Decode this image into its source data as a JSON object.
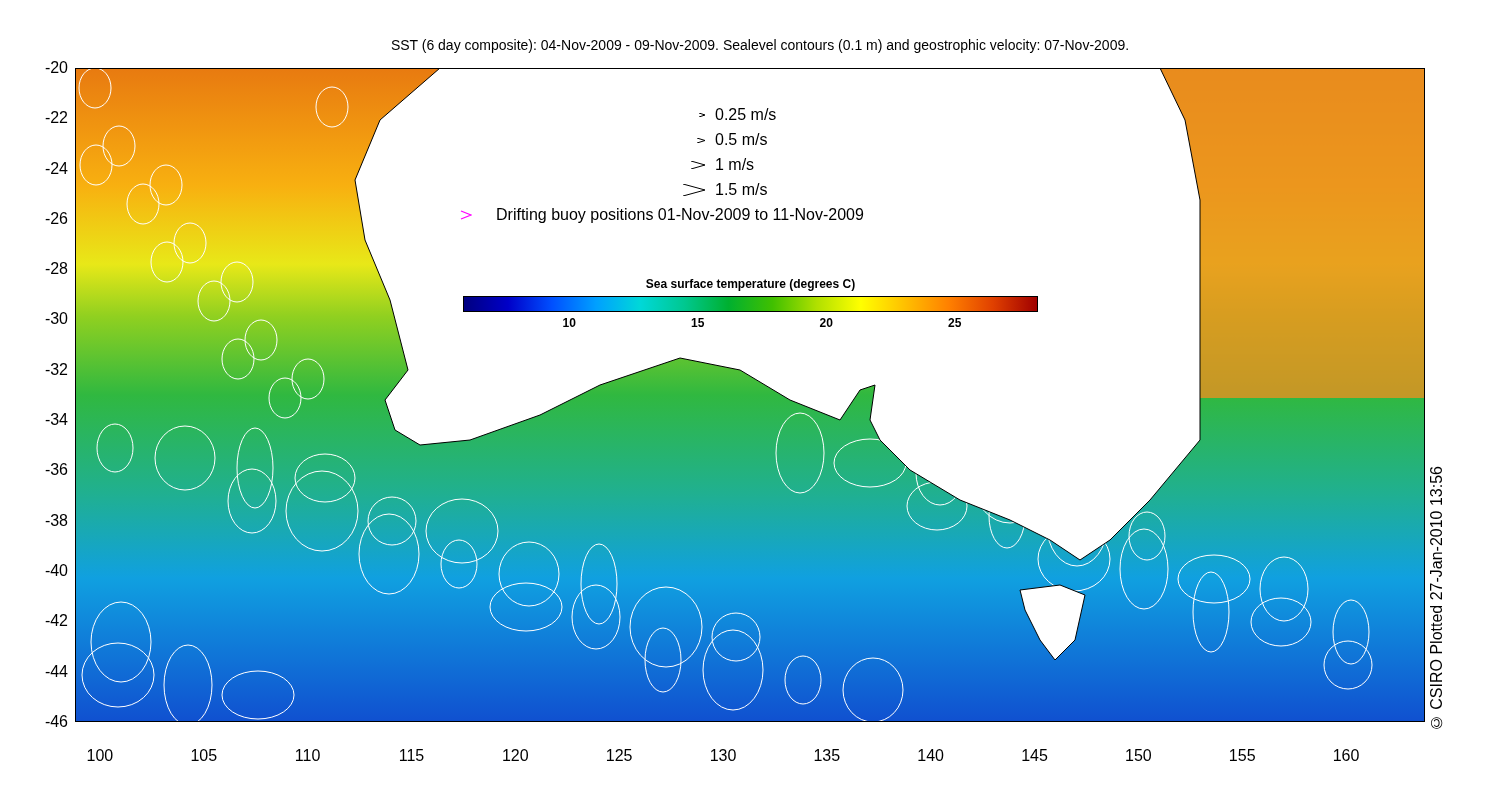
{
  "title": "SST (6 day composite): 04-Nov-2009 - 09-Nov-2009. Sealevel contours (0.1 m) and geostrophic velocity: 07-Nov-2009.",
  "legend": [
    {
      "kind": "arrow",
      "label": "0.25 m/s"
    },
    {
      "kind": "arrow",
      "label": "0.5 m/s"
    },
    {
      "kind": "arrow",
      "label": "1 m/s"
    },
    {
      "kind": "arrow",
      "label": "1.5 m/s"
    },
    {
      "kind": "buoy",
      "label": "Drifting buoy positions 01-Nov-2009 to 11-Nov-2009"
    }
  ],
  "colorbar": {
    "title": "Sea surface temperature (degrees C)",
    "ticks": [
      "10",
      "15",
      "20",
      "25"
    ]
  },
  "y_ticks": [
    "-20",
    "-22",
    "-24",
    "-26",
    "-28",
    "-30",
    "-32",
    "-34",
    "-36",
    "-38",
    "-40",
    "-42",
    "-44",
    "-46"
  ],
  "x_ticks": [
    "100",
    "105",
    "110",
    "115",
    "120",
    "125",
    "130",
    "135",
    "140",
    "145",
    "150",
    "155",
    "160"
  ],
  "credit": "© CSIRO Plotted 27-Jan-2010 13:56"
}
